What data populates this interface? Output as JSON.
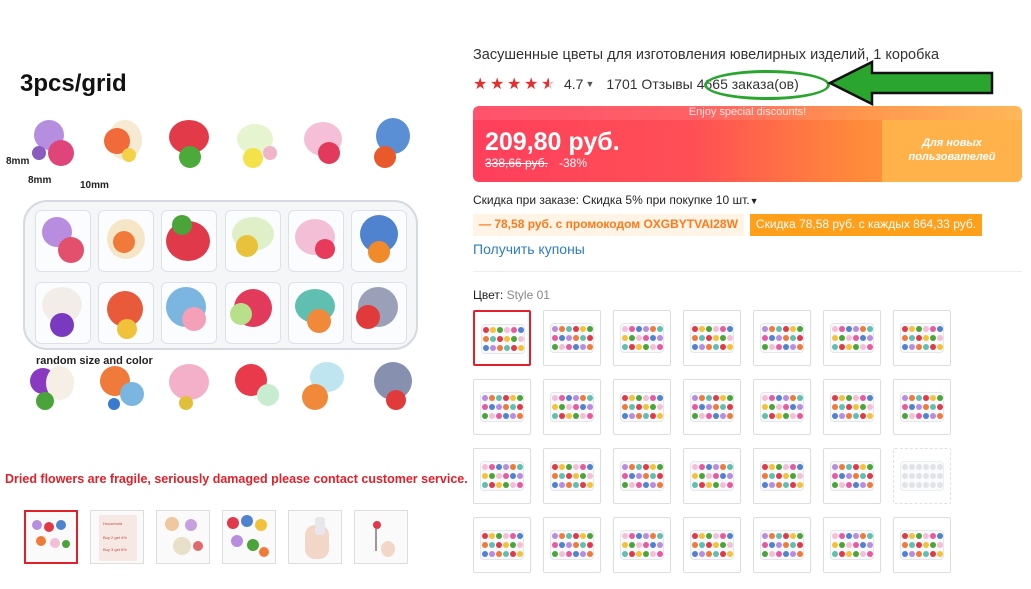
{
  "image": {
    "grid_label": "3pcs/grid",
    "dim_8mm_a": "8mm",
    "dim_8mm_b": "8mm",
    "dim_10mm": "10mm",
    "random_label": "random size and color",
    "fragile_note": "Dried flowers are fragile, seriously damaged please contact customer service."
  },
  "thumbnails": [
    {
      "name": "thumb-1",
      "selected": true
    },
    {
      "name": "thumb-2",
      "selected": false
    },
    {
      "name": "thumb-3",
      "selected": false
    },
    {
      "name": "thumb-4",
      "selected": false
    },
    {
      "name": "thumb-5",
      "selected": false
    },
    {
      "name": "thumb-6",
      "selected": false
    }
  ],
  "product": {
    "title": "Засушенные цветы для изготовления ювелирных изделий, 1 коробка",
    "rating": "4.7",
    "star_fill": 4.7,
    "reviews": "1701 Отзывы",
    "orders": "4665 заказа(ов)"
  },
  "price": {
    "banner_top": "Enjoy special discounts!",
    "current": "209,80 руб.",
    "old": "338,66 руб.",
    "discount": "-38%",
    "new_users": "Для новых пользователей"
  },
  "discounts": {
    "bulk": "Скидка при заказе: Скидка 5% при покупке 10 шт.",
    "promo_code": "— 78,58 руб. с промокодом OXGBYTVAI28W",
    "store_discount": "Скидка 78,58 руб. с каждых 864,33 руб.",
    "coupons_link": "Получить купоны"
  },
  "color": {
    "label": "Цвет:",
    "selected": "Style 01"
  },
  "colors": {
    "accent": "#e0202a",
    "link": "#2f7cc4",
    "promo_orange": "#ff9f1a",
    "annotation_green": "#2aa62e"
  }
}
